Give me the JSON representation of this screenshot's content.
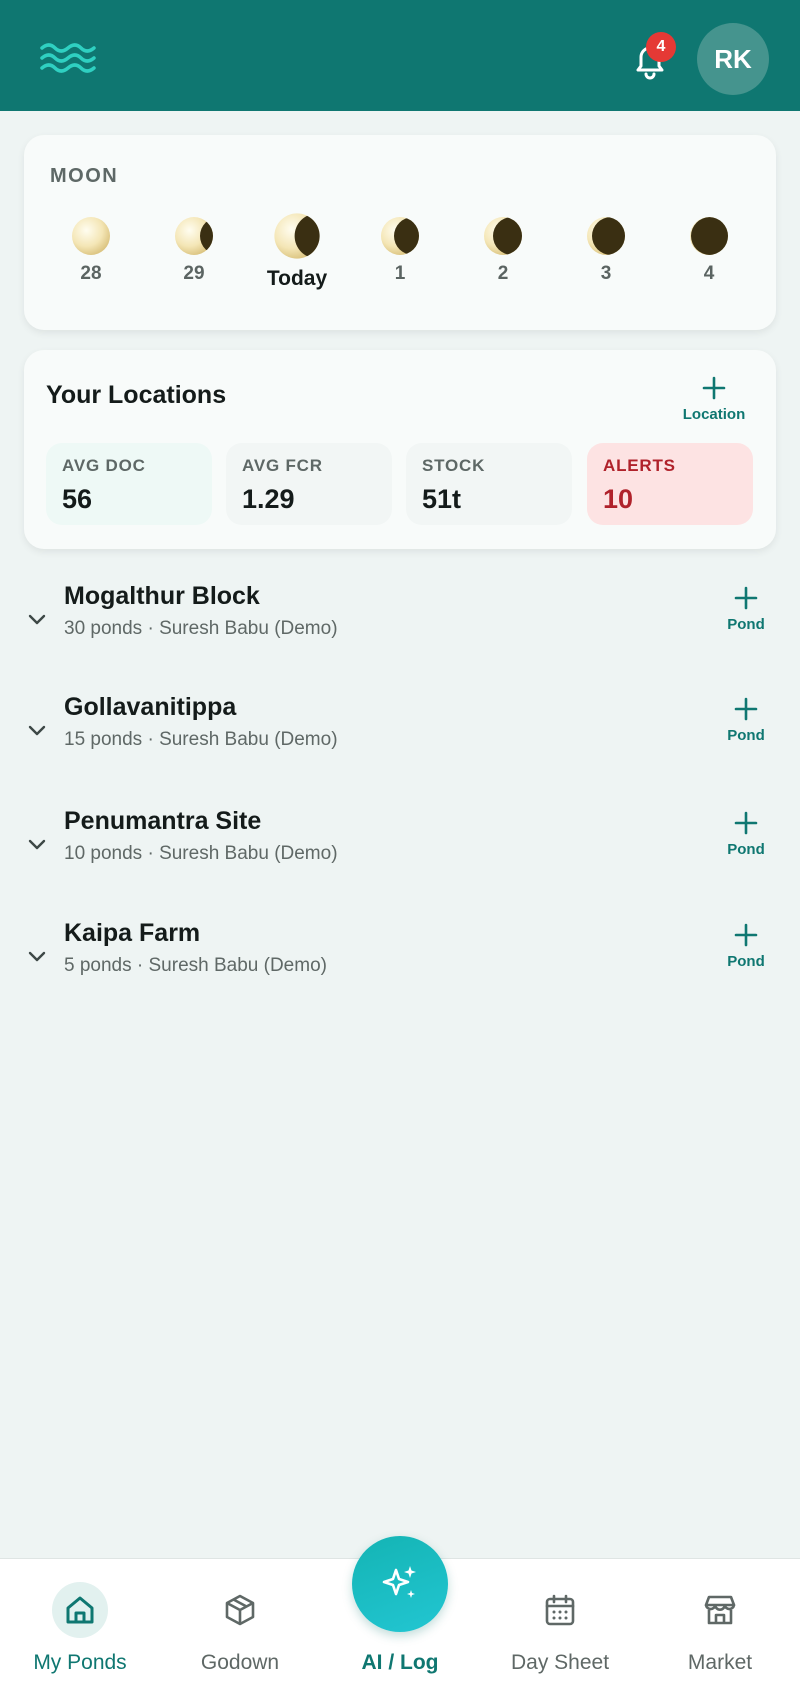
{
  "header": {
    "logo_icon": "waves-icon",
    "notifications": {
      "icon": "bell-icon",
      "count": "4"
    },
    "avatar_initials": "RK"
  },
  "moon": {
    "title": "MOON",
    "days": [
      {
        "label": "28",
        "phase": "full"
      },
      {
        "label": "29",
        "phase": "near-full"
      },
      {
        "label": "Today",
        "phase": "waning-1",
        "today": true
      },
      {
        "label": "1",
        "phase": "waning-2"
      },
      {
        "label": "2",
        "phase": "waning-3"
      },
      {
        "label": "3",
        "phase": "waning-4"
      },
      {
        "label": "4",
        "phase": "waning-5"
      }
    ]
  },
  "locations_card": {
    "title": "Your Locations",
    "add_label": "Location",
    "stats": [
      {
        "label": "AVG DOC",
        "value": "56"
      },
      {
        "label": "AVG FCR",
        "value": "1.29"
      },
      {
        "label": "STOCK",
        "value": "51t"
      },
      {
        "label": "ALERTS",
        "value": "10"
      }
    ]
  },
  "locations": [
    {
      "name": "Mogalthur Block",
      "subtitle": "30 ponds · Suresh Babu (Demo)",
      "add_label": "Pond"
    },
    {
      "name": "Gollavanitippa",
      "subtitle": "15 ponds · Suresh Babu (Demo)",
      "add_label": "Pond"
    },
    {
      "name": "Penumantra Site",
      "subtitle": "10 ponds · Suresh Babu (Demo)",
      "add_label": "Pond"
    },
    {
      "name": "Kaipa Farm",
      "subtitle": "5 ponds · Suresh Babu (Demo)",
      "add_label": "Pond"
    }
  ],
  "bottom_nav": [
    {
      "label": "My Ponds",
      "icon": "home-icon",
      "active": true
    },
    {
      "label": "Godown",
      "icon": "box-icon"
    },
    {
      "label": "AI / Log",
      "icon": "sparkle-icon"
    },
    {
      "label": "Day Sheet",
      "icon": "calendar-icon"
    },
    {
      "label": "Market",
      "icon": "store-icon"
    }
  ],
  "colors": {
    "brand": "#0f7771",
    "background": "#eef4f3",
    "alert": "#b0222b",
    "alert_bg": "#fde3e3",
    "ai_accent": "#1dbfc9"
  }
}
